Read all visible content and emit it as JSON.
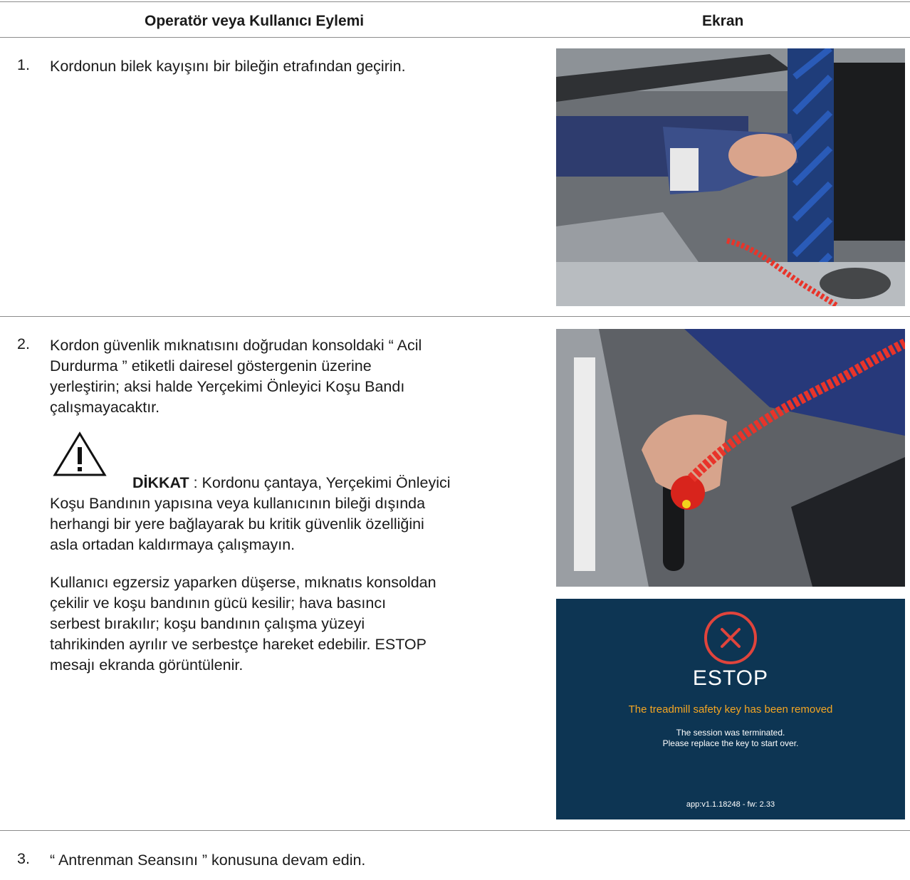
{
  "table": {
    "col_action": "Operatör veya Kullanıcı Eylemi",
    "col_screen": "Ekran"
  },
  "steps": [
    {
      "number": "1.",
      "text": "Kordonun bilek kayışını bir bileğin etrafından geçirin."
    },
    {
      "number": "2.",
      "lines": [
        "Kordon güvenlik mıknatısını doğrudan konsoldaki “ Acil",
        "Durdurma ” etiketli dairesel göstergenin üzerine",
        "yerleştirin; aksi halde Yerçekimi Önleyici Koşu Bandı",
        "çalışmayacaktır."
      ],
      "caution_label": "DİKKAT",
      "caution_lines": [
        " : Kordonu çantaya, Yerçekimi Önleyici",
        "Koşu Bandının yapısına veya kullanıcının bileği dışında",
        "herhangi bir yere bağlayarak bu kritik güvenlik özelliğini",
        "asla ortadan kaldırmaya çalışmayın."
      ],
      "note_lines": [
        "Kullanıcı egzersiz yaparken düşerse, mıknatıs konsoldan",
        "çekilir ve koşu bandının gücü kesilir; hava basıncı",
        "serbest bırakılır; koşu bandının çalışma yüzeyi",
        "tahrikinden ayrılır ve serbestçe hareket edebilir. ESTOP",
        "mesajı ekranda görüntülenir."
      ]
    },
    {
      "number": "3.",
      "text": "“ Antrenman Seansını ” konusuna devam edin."
    }
  ],
  "estop_screen": {
    "title": "ESTOP",
    "warning": "The treadmill safety key has been removed",
    "line1": "The session was terminated.",
    "line2": "Please replace the key to start over.",
    "version": "app:v1.1.18248 - fw: 2.33"
  },
  "icons": {
    "warning": "warning-triangle-icon",
    "error": "error-x-circle-icon"
  },
  "colors": {
    "screen_bg": "#0d3553",
    "warning_text": "#f5a623",
    "error_ring": "#e0443c",
    "cord": "#e8342a"
  }
}
